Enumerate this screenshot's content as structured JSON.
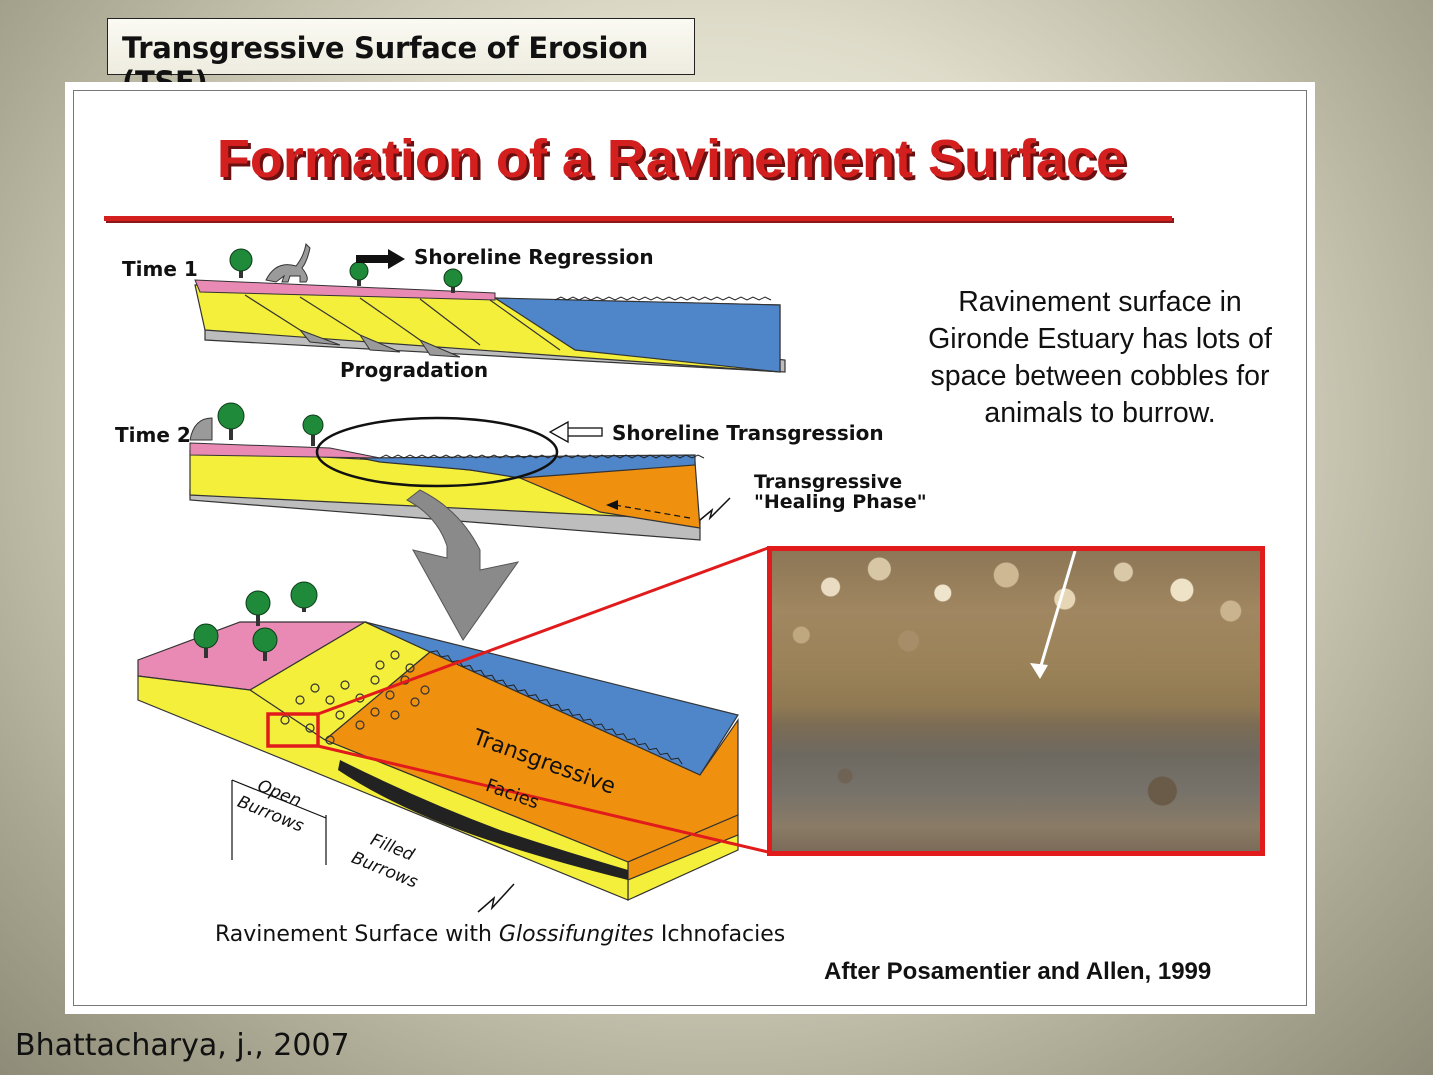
{
  "slide_title": "Transgressive Surface of Erosion (TSE)",
  "figure": {
    "title": "Formation of a Ravinement Surface",
    "labels": {
      "time1": "Time 1",
      "time2": "Time 2",
      "shoreline_regression": "Shoreline Regression",
      "progradation": "Progradation",
      "shoreline_transgression": "Shoreline Transgression",
      "healing_phase_line1": "Transgressive",
      "healing_phase_line2": "\"Healing Phase\"",
      "transgressive_facies_1": "Transgressive",
      "transgressive_facies_2": "Facies",
      "open_burrows_1": "Open",
      "open_burrows_2": "Burrows",
      "filled_burrows_1": "Filled",
      "filled_burrows_2": "Burrows"
    },
    "caption_prefix": "Ravinement Surface with ",
    "caption_italic": "Glossifungites",
    "caption_suffix": " Ichnofacies",
    "credit": "After Posamentier and Allen, 1999",
    "description": "Ravinement surface in Gironde Estuary has lots of space between cobbles for animals to burrow."
  },
  "footer_citation": "Bhattacharya, j., 2007",
  "colors": {
    "title_red": "#d41f1f",
    "sand_yellow": "#f4ef3a",
    "marine_blue": "#4f86c9",
    "coastal_pink": "#e98ab5",
    "transgressive_orange": "#f0900f",
    "shale_gray": "#b9b9b9"
  }
}
